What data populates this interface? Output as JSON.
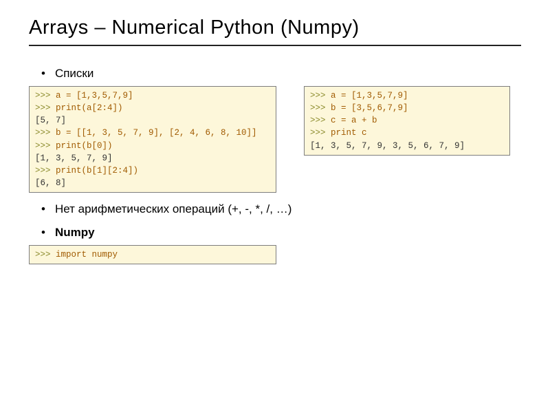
{
  "title": "Arrays – Numerical Python (Numpy)",
  "bullets": {
    "lists": "Списки",
    "noarith": "Нет арифметических операций (+, -, *, /, …)",
    "numpy": "Numpy"
  },
  "code": {
    "left": {
      "l1p": ">>> ",
      "l1": "a = [1,3,5,7,9]",
      "l2p": ">>> ",
      "l2": "print(a[2:4])",
      "l3": "[5, 7]",
      "l4p": ">>> ",
      "l4": "b = [[1, 3, 5, 7, 9], [2, 4, 6, 8, 10]]",
      "l5p": ">>> ",
      "l5": "print(b[0])",
      "l6": "[1, 3, 5, 7, 9]",
      "l7p": ">>> ",
      "l7": "print(b[1][2:4])",
      "l8": "[6, 8]"
    },
    "right": {
      "r1p": ">>> ",
      "r1": "a = [1,3,5,7,9]",
      "r2p": ">>> ",
      "r2": "b = [3,5,6,7,9]",
      "r3p": ">>> ",
      "r3": "c = a + b",
      "r4p": ">>> ",
      "r4": "print c",
      "r5": "[1, 3, 5, 7, 9, 3, 5, 6, 7, 9]"
    },
    "import": {
      "p": ">>> ",
      "stmt": "import numpy"
    }
  }
}
